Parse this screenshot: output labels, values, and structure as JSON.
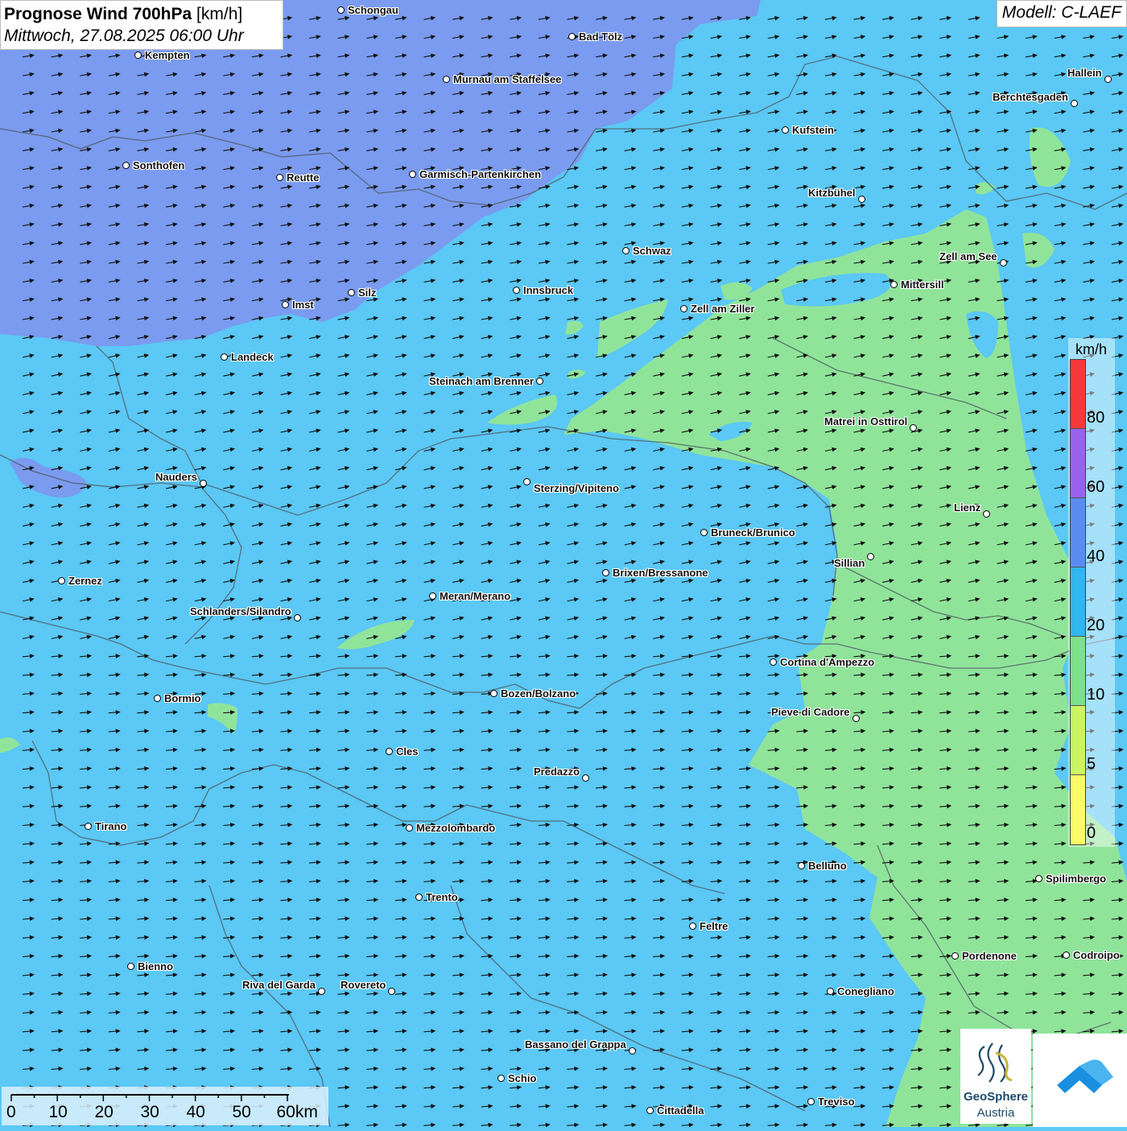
{
  "title": {
    "main_bold": "Prognose Wind 700hPa",
    "unit": "[km/h]",
    "datetime": "Mittwoch, 27.08.2025 06:00 Uhr"
  },
  "model_label": "Modell: C-LAEF",
  "legend": {
    "unit": "km/h",
    "segments": [
      {
        "color": "#f73838"
      },
      {
        "color": "#9a62ec"
      },
      {
        "color": "#5a8cf0"
      },
      {
        "color": "#31b6ef"
      },
      {
        "color": "#7ee08a"
      },
      {
        "color": "#caf562"
      },
      {
        "color": "#fbfb6a"
      }
    ],
    "ticks": [
      "80",
      "60",
      "40",
      "20",
      "10",
      "5",
      "0"
    ]
  },
  "scale": {
    "labels": [
      "0",
      "10",
      "20",
      "30",
      "40",
      "50",
      "60km"
    ]
  },
  "logo": {
    "name_line1": "GeoSphere",
    "name_line2": "Austria"
  },
  "cities": [
    {
      "name": "Schongau"
    },
    {
      "name": "Bad Tölz"
    },
    {
      "name": "Kempten"
    },
    {
      "name": "Murnau am Staffelsee"
    },
    {
      "name": "Hallein"
    },
    {
      "name": "Berchtesgaden"
    },
    {
      "name": "Kufstein"
    },
    {
      "name": "Sonthofen"
    },
    {
      "name": "Reutte"
    },
    {
      "name": "Garmisch-Partenkirchen"
    },
    {
      "name": "Kitzbühel"
    },
    {
      "name": "Schwaz"
    },
    {
      "name": "Zell am See"
    },
    {
      "name": "Mittersill"
    },
    {
      "name": "Innsbruck"
    },
    {
      "name": "Silz"
    },
    {
      "name": "Imst"
    },
    {
      "name": "Zell am Ziller"
    },
    {
      "name": "Landeck"
    },
    {
      "name": "Steinach am Brenner"
    },
    {
      "name": "Matrei in Osttirol"
    },
    {
      "name": "Nauders"
    },
    {
      "name": "Sterzing/Vipiteno"
    },
    {
      "name": "Lienz"
    },
    {
      "name": "Bruneck/Brunico"
    },
    {
      "name": "Sillian"
    },
    {
      "name": "Brixen/Bressanone"
    },
    {
      "name": "Zernez"
    },
    {
      "name": "Meran/Merano"
    },
    {
      "name": "Schlanders/Silandro"
    },
    {
      "name": "Cortina d'Ampezzo"
    },
    {
      "name": "Bozen/Bolzano"
    },
    {
      "name": "Bormio"
    },
    {
      "name": "Pieve di Cadore"
    },
    {
      "name": "Cles"
    },
    {
      "name": "Predazzo"
    },
    {
      "name": "Tirano"
    },
    {
      "name": "Mezzolombardo"
    },
    {
      "name": "Belluno"
    },
    {
      "name": "Spilimbergo"
    },
    {
      "name": "Trento"
    },
    {
      "name": "Feltre"
    },
    {
      "name": "Pordenone"
    },
    {
      "name": "Codroipo"
    },
    {
      "name": "Bienno"
    },
    {
      "name": "Riva del Garda"
    },
    {
      "name": "Rovereto"
    },
    {
      "name": "Conegliano"
    },
    {
      "name": "Bassano del Grappa"
    },
    {
      "name": "Schio"
    },
    {
      "name": "Treviso"
    },
    {
      "name": "Cittadella"
    }
  ]
}
